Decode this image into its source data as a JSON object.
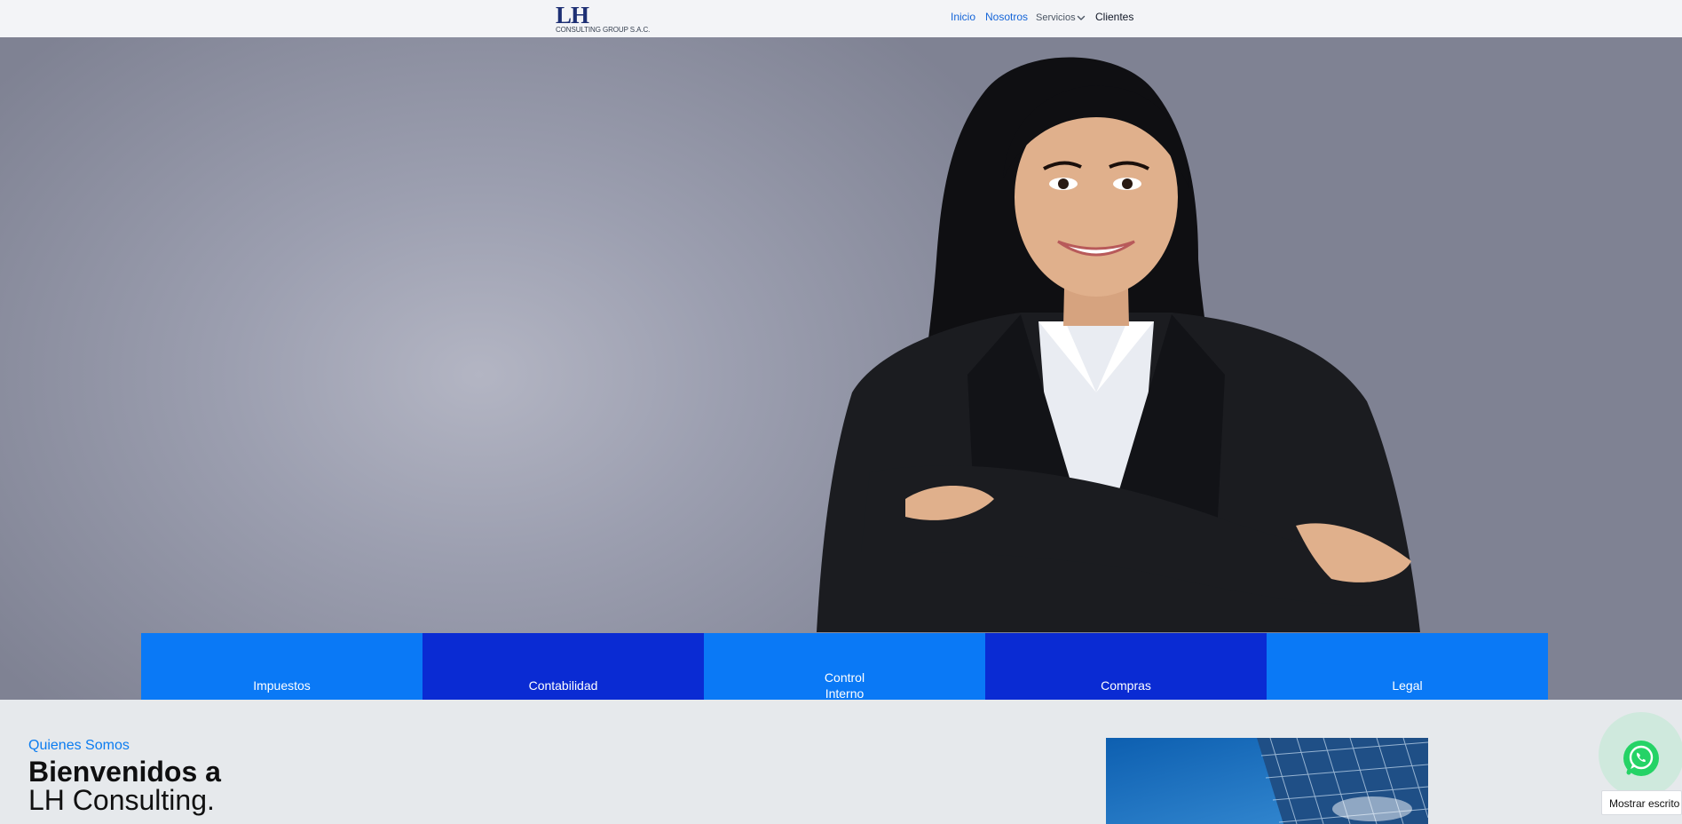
{
  "header": {
    "logo": {
      "mark": "LH",
      "subtitle": "CONSULTING GROUP S.A.C."
    },
    "nav": {
      "inicio": "Inicio",
      "nosotros": "Nosotros",
      "servicios": "Servicios",
      "clientes": "Clientes"
    },
    "icons": {
      "servicios_dropdown": "chevron-down-icon"
    }
  },
  "hero": {
    "tiles": [
      {
        "label": "Impuestos"
      },
      {
        "label": "Contabilidad"
      },
      {
        "label": "Control Interno"
      },
      {
        "label": "Compras"
      },
      {
        "label": "Legal"
      }
    ],
    "colors": {
      "tile_light": "#0a79f6",
      "tile_dark": "#0a2bd3"
    }
  },
  "about": {
    "kicker": "Quienes Somos",
    "title_bold": "Bienvenidos a",
    "title_regular": "LH Consulting."
  },
  "whatsapp": {
    "icon": "whatsapp-icon",
    "tooltip": "Mostrar escrito"
  },
  "colors": {
    "accent": "#0b7cf0",
    "nav_link": "#1565d8",
    "whatsapp_green": "#25d366"
  }
}
